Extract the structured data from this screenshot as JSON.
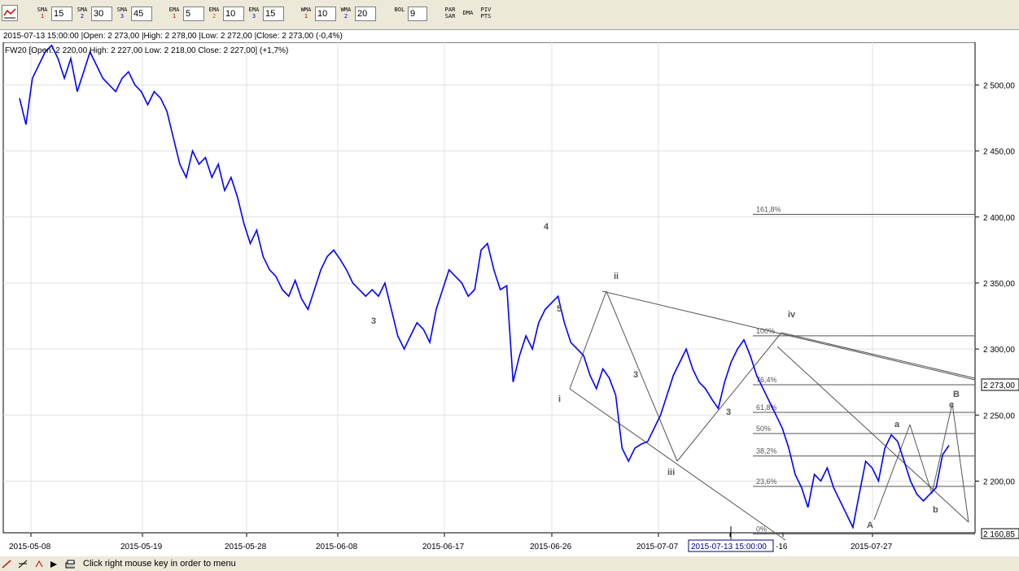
{
  "toolbar": {
    "indicators": [
      {
        "name": "SMA",
        "num": "1",
        "value": "15",
        "color": "#c00000"
      },
      {
        "name": "SMA",
        "num": "2",
        "value": "30",
        "color": "#0000c0"
      },
      {
        "name": "SMA",
        "num": "3",
        "value": "45",
        "color": "#0000c0"
      },
      {
        "name": "EMA",
        "num": "1",
        "value": "5",
        "color": "#c00000"
      },
      {
        "name": "EMA",
        "num": "2",
        "value": "10",
        "color": "#c06000"
      },
      {
        "name": "EMA",
        "num": "3",
        "value": "15",
        "color": "#0000c0"
      },
      {
        "name": "WMA",
        "num": "1",
        "value": "10",
        "color": "#c00000"
      },
      {
        "name": "WMA",
        "num": "2",
        "value": "20",
        "color": "#0000c0"
      }
    ],
    "bol_label": "BOL",
    "bol_value": "9",
    "par_sar": [
      "PAR",
      "SAR"
    ],
    "dma": "DMA",
    "piv_pts": [
      "PIV",
      "PTS"
    ]
  },
  "info_line": "2015-07-13 15:00:00 |Open: 2 273,00 |High: 2 278,00 |Low: 2 272,00 |Close: 2 273,00 (-0,4%)",
  "chart_data": {
    "type": "line",
    "title": "FW20 [Open: 2 220,00  High: 2 227,00  Low: 2 218,00  Close: 2 227,00] (+1,7%)",
    "series_color": "#0000ff",
    "ylim": [
      2160.85,
      2520
    ],
    "y_ticks": [
      2200,
      2250,
      2300,
      2350,
      2400,
      2450,
      2500
    ],
    "y_tick_labels": [
      "2 200,00",
      "2 250,00",
      "2 300,00",
      "2 350,00",
      "2 400,00",
      "2 450,00",
      "2 500,00"
    ],
    "x_tick_labels": [
      "2015-05-08",
      "2015-05-19",
      "2015-05-28",
      "2015-06-08",
      "2015-06-17",
      "2015-06-26",
      "2015-07-07",
      "2015-07-13 15:00:00",
      "-16",
      "2015-07-27"
    ],
    "current_price": "2 273,00",
    "min_price": "2 160,85",
    "series": [
      {
        "values": [
          2490,
          2470,
          2505,
          2515,
          2525,
          2530,
          2520,
          2505,
          2520,
          2495,
          2510,
          2525,
          2515,
          2505,
          2500,
          2495,
          2505,
          2510,
          2500,
          2495,
          2485,
          2495,
          2490,
          2480,
          2460,
          2440,
          2430,
          2450,
          2440,
          2445,
          2430,
          2440,
          2420,
          2430,
          2415,
          2395,
          2380,
          2390,
          2370,
          2360,
          2355,
          2345,
          2340,
          2352,
          2338,
          2330,
          2345,
          2360,
          2370,
          2375,
          2368,
          2360,
          2350,
          2345,
          2340,
          2345,
          2340,
          2350,
          2330,
          2310,
          2300,
          2310,
          2320,
          2315,
          2305,
          2330,
          2345,
          2360,
          2355,
          2350,
          2340,
          2345,
          2375,
          2380,
          2360,
          2345,
          2348,
          2275,
          2295,
          2310,
          2300,
          2320,
          2330,
          2335,
          2340,
          2320,
          2305,
          2300,
          2295,
          2280,
          2270,
          2285,
          2278,
          2265,
          2225,
          2215,
          2225,
          2228,
          2230,
          2240,
          2250,
          2265,
          2280,
          2290,
          2300,
          2285,
          2275,
          2270,
          2262,
          2255,
          2275,
          2290,
          2300,
          2307,
          2295,
          2280,
          2270,
          2260,
          2250,
          2240,
          2225,
          2205,
          2195,
          2180,
          2205,
          2200,
          2210,
          2195,
          2185,
          2175,
          2165,
          2190,
          2215,
          2210,
          2200,
          2225,
          2235,
          2230,
          2215,
          2200,
          2190,
          2185,
          2190,
          2195,
          2220,
          2227
        ]
      }
    ],
    "fib_labels": [
      "161,8%",
      "100%",
      "76,4%",
      "61,8%",
      "50%",
      "38,2%",
      "23,6%",
      "0%"
    ],
    "fib_levels": [
      2402,
      2310,
      2273,
      2252,
      2236,
      2219,
      2196,
      2160
    ],
    "wave_labels": [
      "4",
      "5",
      "3",
      "i",
      "ii",
      "3",
      "iii",
      "3",
      "iv",
      "A",
      "a",
      "b",
      "c",
      "B"
    ],
    "timeline_cursor": "2015-07-13 15:00:00"
  },
  "status": {
    "message": "Click right mouse key in order to menu"
  }
}
